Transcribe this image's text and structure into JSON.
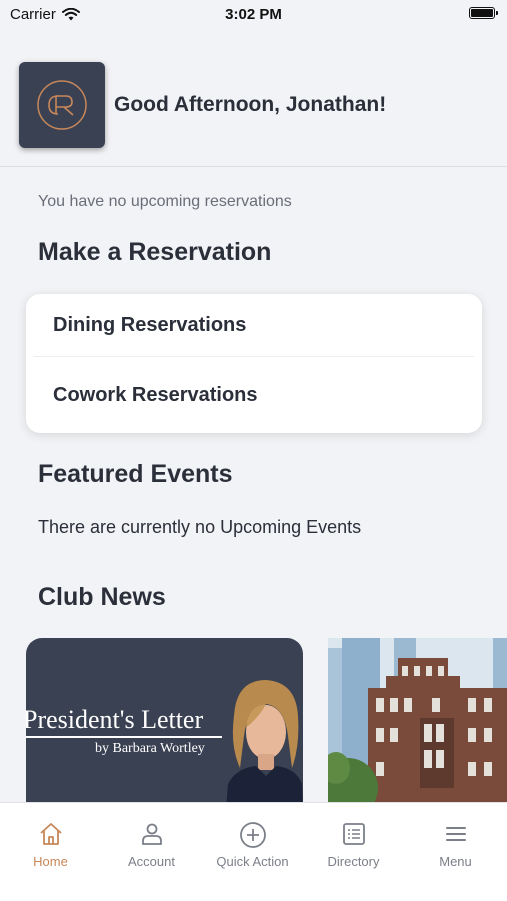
{
  "status_bar": {
    "carrier": "Carrier",
    "time": "3:02 PM"
  },
  "header": {
    "greeting": "Good Afternoon, Jonathan!"
  },
  "reservations": {
    "empty_text": "You have no upcoming reservations",
    "title": "Make a Reservation",
    "items": [
      {
        "label": "Dining Reservations"
      },
      {
        "label": "Cowork Reservations"
      }
    ]
  },
  "events": {
    "title": "Featured Events",
    "empty_text": "There are currently no Upcoming Events"
  },
  "news": {
    "title": "Club News",
    "cards": [
      {
        "headline": "President's Letter",
        "byline": "by Barbara Wortley"
      },
      {
        "headline": ""
      }
    ]
  },
  "tab_bar": {
    "items": [
      {
        "label": "Home",
        "icon": "home-icon",
        "active": true
      },
      {
        "label": "Account",
        "icon": "account-icon",
        "active": false
      },
      {
        "label": "Quick Action",
        "icon": "plus-circle-icon",
        "active": false
      },
      {
        "label": "Directory",
        "icon": "directory-icon",
        "active": false
      },
      {
        "label": "Menu",
        "icon": "menu-icon",
        "active": false
      }
    ]
  },
  "colors": {
    "background": "#f2f3f6",
    "brand_navy": "#394152",
    "accent_copper": "#c7875a",
    "text_dark": "#2b2f3a",
    "tab_inactive": "#7b7f88"
  }
}
